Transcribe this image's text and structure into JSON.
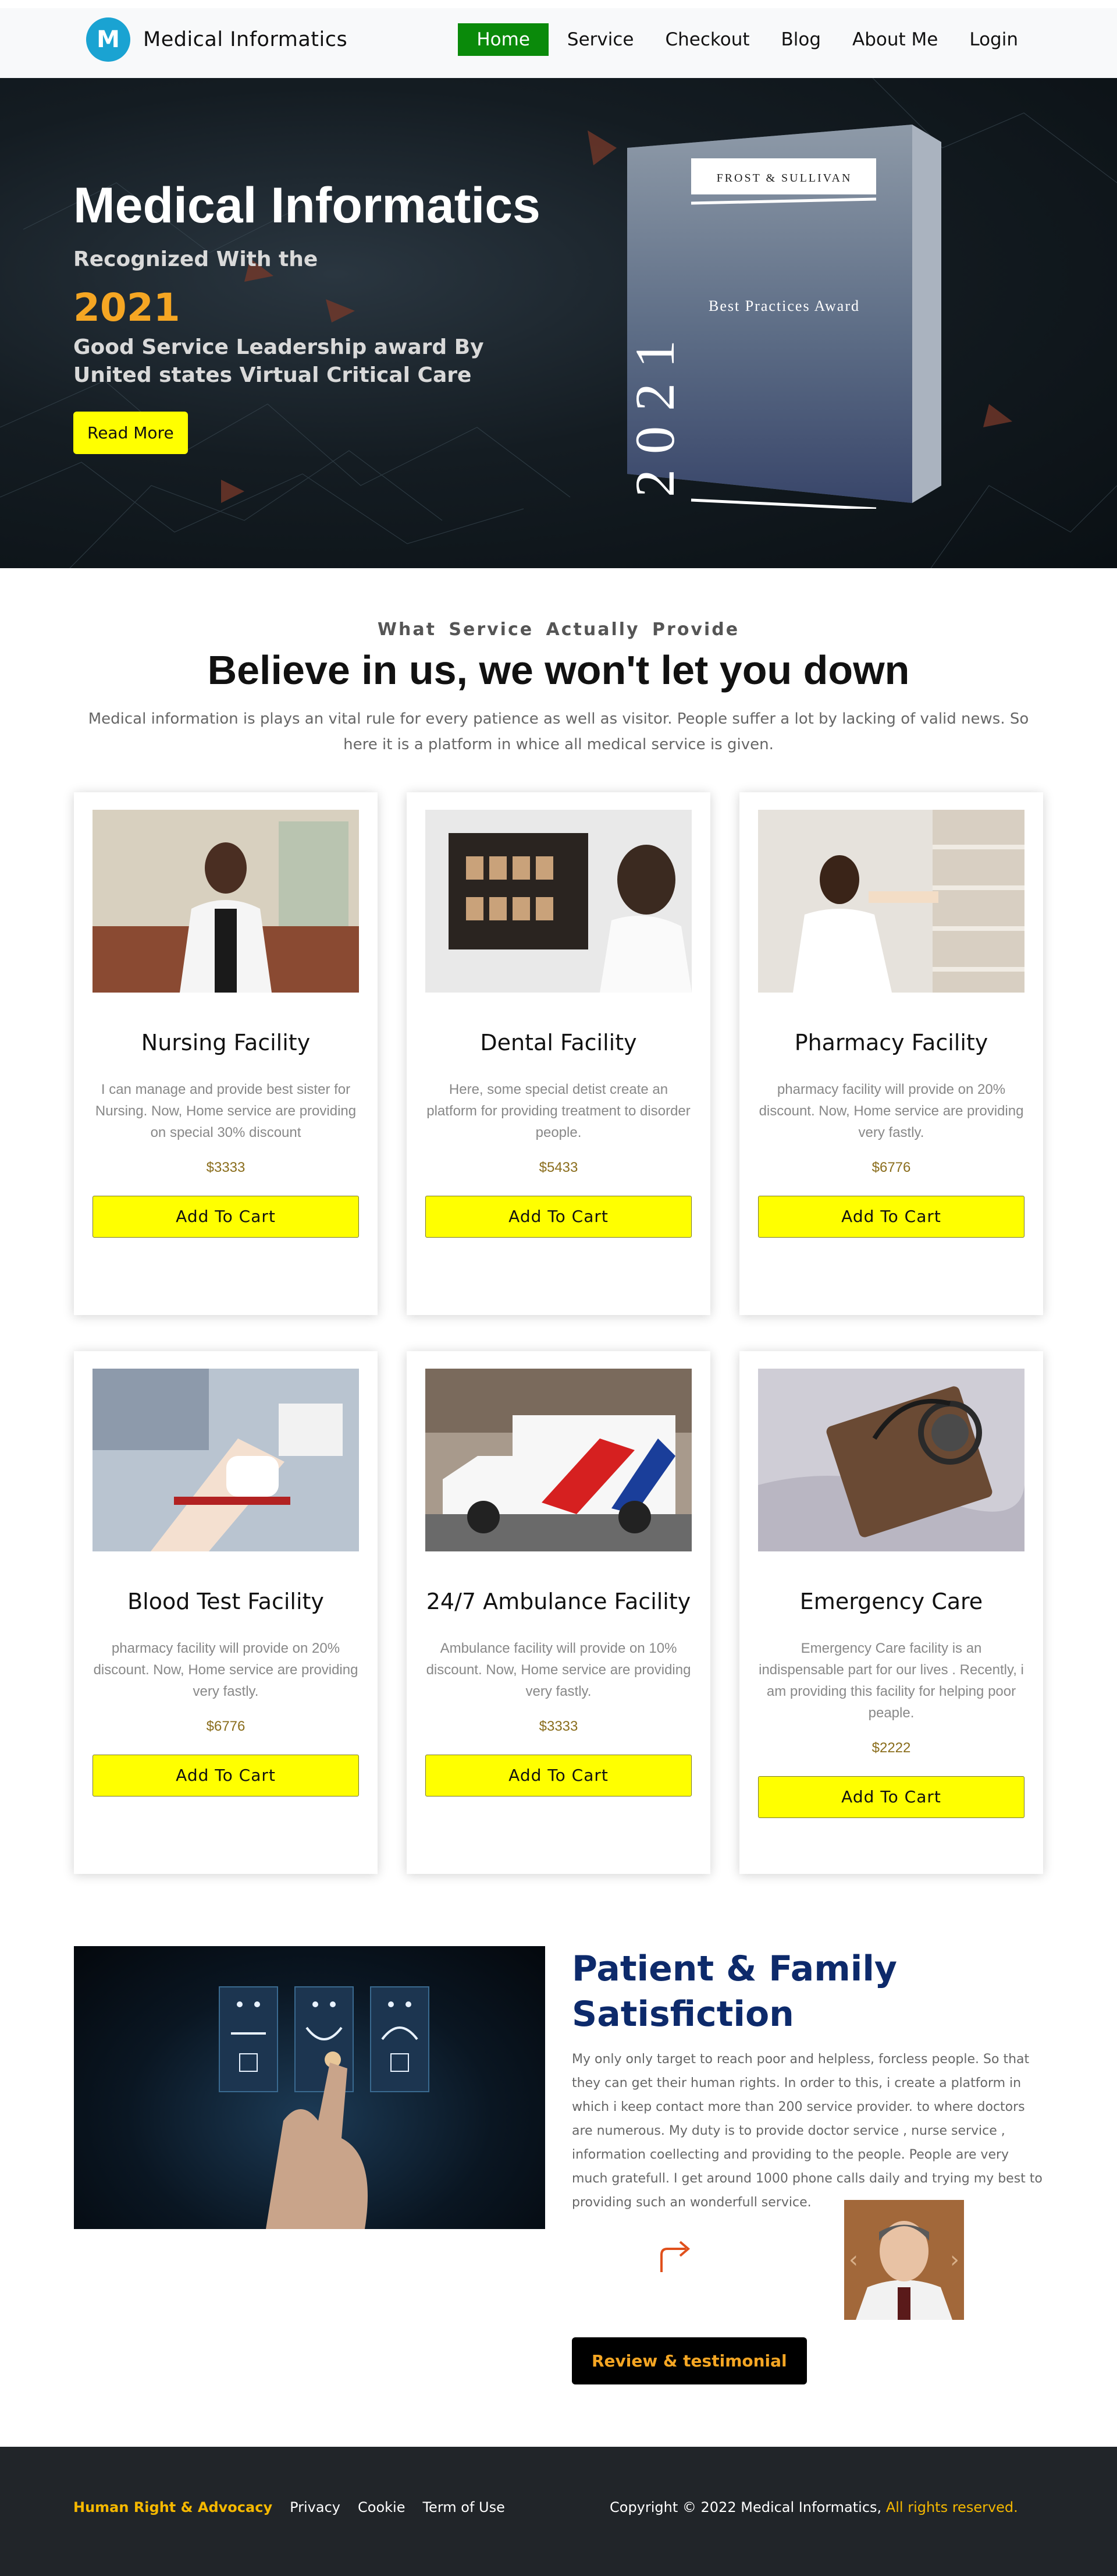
{
  "header": {
    "logo_letter": "M",
    "brand": "Medical Informatics",
    "nav": [
      {
        "label": "Home",
        "active": true
      },
      {
        "label": "Service"
      },
      {
        "label": "Checkout"
      },
      {
        "label": "Blog"
      },
      {
        "label": "About Me"
      },
      {
        "label": "Login"
      }
    ]
  },
  "hero": {
    "title": "Medical Informatics",
    "subtitle": "Recognized With the",
    "year": "2021",
    "description": "Good Service Leadership award By United states Virtual Critical Care",
    "button": "Read More",
    "award": {
      "year_text": "2021",
      "plate_text": "FROST & SULLIVAN",
      "award_text": "Best Practices Award"
    }
  },
  "services": {
    "eyebrow": "What Service Actually Provide",
    "title": "Believe in us, we won't let you down",
    "description": "Medical information is plays an vital rule for every patience as well as visitor. People suffer a lot by lacking of valid news. So here it is a platform in whice all medical service is given.",
    "cards": [
      {
        "title": "Nursing Facility",
        "desc": "I can manage and provide best sister for Nursing. Now, Home service are providing on special 30% discount",
        "price": "$3333",
        "button": "Add To Cart",
        "image": "nurse"
      },
      {
        "title": "Dental Facility",
        "desc": "Here, some special detist create an platform for providing treatment to disorder people.",
        "price": "$5433",
        "button": "Add To Cart",
        "image": "xray"
      },
      {
        "title": "Pharmacy Facility",
        "desc": "pharmacy facility will provide on 20% discount. Now, Home service are providing very fastly.",
        "price": "$6776",
        "button": "Add To Cart",
        "image": "pharmacy"
      },
      {
        "title": "Blood Test Facility",
        "desc": "pharmacy facility will provide on 20% discount. Now, Home service are providing very fastly.",
        "price": "$6776",
        "button": "Add To Cart",
        "image": "blood"
      },
      {
        "title": "24/7 Ambulance Facility",
        "desc": "Ambulance facility will provide on 10% discount. Now, Home service are providing very fastly.",
        "price": "$3333",
        "button": "Add To Cart",
        "image": "ambulance"
      },
      {
        "title": "Emergency Care",
        "desc": "Emergency Care facility is an indispensable part for our lives . Recently, i am providing this facility for helping poor peaple.",
        "price": "$2222",
        "button": "Add To Cart",
        "image": "stethoscope"
      }
    ]
  },
  "satisfaction": {
    "title": "Patient & Family Satisfiction",
    "body": "My only only target to reach poor and helpless, forcless people. So that they can get their human rights. In order to this, i create a platform in which i keep contact more than 200 service provider. to where doctors are numerous. My duty is to provide doctor service , nurse service , information coellecting and providing to the people. People are very much gratefull. I get around 1000 phone calls daily and trying my best to providing such an wonderfull service.",
    "prev": "‹",
    "next": "›",
    "button": "Review & testimonial"
  },
  "footer": {
    "links": [
      "Human Right & Advocacy",
      "Privacy",
      "Cookie",
      "Term of Use"
    ],
    "copyright": "Copyright © 2022 Medical Informatics,",
    "rights": "All rights reserved."
  },
  "colors": {
    "accent_yellow": "#ffff00",
    "nav_active": "#0a8a0a",
    "orange": "#f5a623",
    "navy": "#0d2a6b",
    "footer_bg": "#212529"
  }
}
